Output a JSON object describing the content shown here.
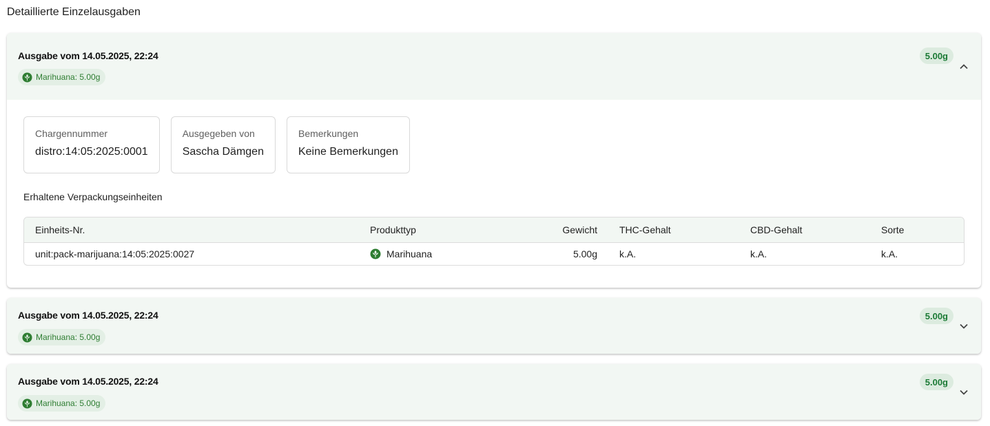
{
  "page": {
    "title": "Detaillierte Einzelausgaben"
  },
  "colors": {
    "accent": "#2e7d32",
    "header_bg": "#f2f7f3",
    "badge_bg": "#dcebdf"
  },
  "panels": [
    {
      "title": "Ausgabe vom 14.05.2025, 22:24",
      "chip": "Marihuana: 5.00g",
      "total": "5.00g",
      "expanded": true,
      "details": {
        "charge_label": "Chargennummer",
        "charge_value": "distro:14:05:2025:0001",
        "issuer_label": "Ausgegeben von",
        "issuer_value": "Sascha Dämgen",
        "notes_label": "Bemerkungen",
        "notes_value": "Keine Bemerkungen"
      },
      "units_title": "Erhaltene Verpackungseinheiten",
      "table": {
        "headers": [
          "Einheits-Nr.",
          "Produkttyp",
          "Gewicht",
          "THC-Gehalt",
          "CBD-Gehalt",
          "Sorte"
        ],
        "rows": [
          [
            "unit:pack-marijuana:14:05:2025:0027",
            "Marihuana",
            "5.00g",
            "k.A.",
            "k.A.",
            "k.A."
          ]
        ]
      }
    },
    {
      "title": "Ausgabe vom 14.05.2025, 22:24",
      "chip": "Marihuana: 5.00g",
      "total": "5.00g",
      "expanded": false
    },
    {
      "title": "Ausgabe vom 14.05.2025, 22:24",
      "chip": "Marihuana: 5.00g",
      "total": "5.00g",
      "expanded": false
    }
  ]
}
